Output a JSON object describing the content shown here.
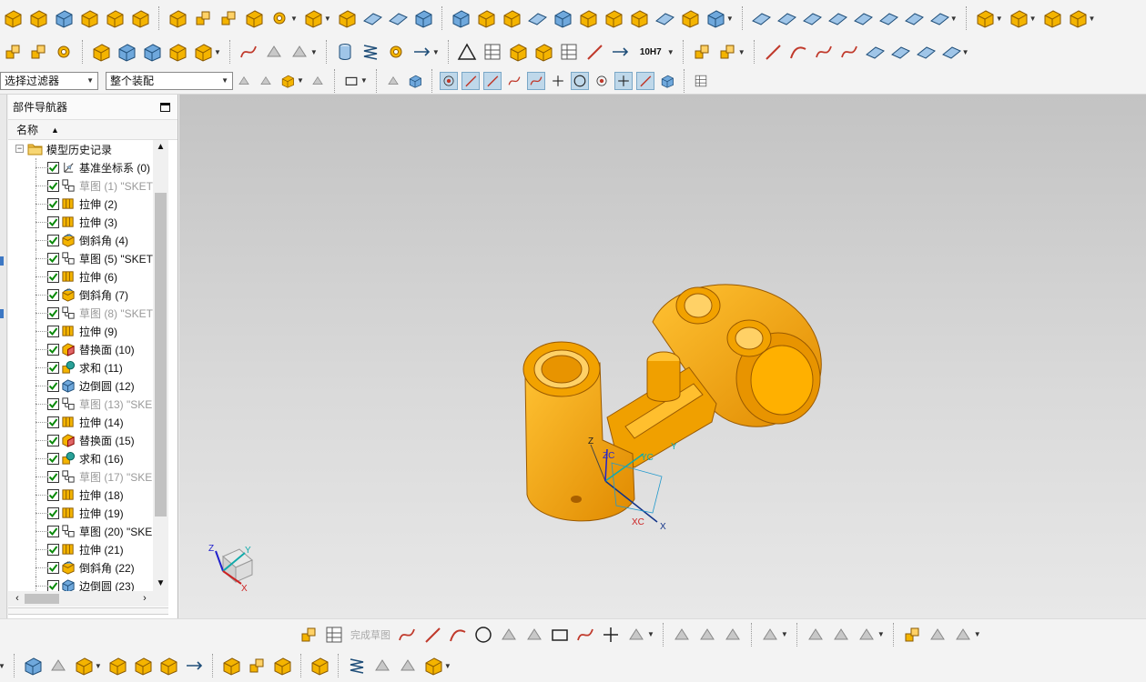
{
  "selection_filter": {
    "value": "选择过滤器"
  },
  "assembly_scope": {
    "value": "整个装配"
  },
  "navigator": {
    "title": "部件导航器",
    "column_header": "名称",
    "root_label": "模型历史记录",
    "items": [
      {
        "label": "基准坐标系 (0)",
        "type": "datum",
        "suppressed": false
      },
      {
        "label": "草图 (1) \"SKET",
        "type": "sketch",
        "suppressed": true
      },
      {
        "label": "拉伸 (2)",
        "type": "extrude",
        "suppressed": false
      },
      {
        "label": "拉伸 (3)",
        "type": "extrude",
        "suppressed": false
      },
      {
        "label": "倒斜角 (4)",
        "type": "chamfer",
        "suppressed": false
      },
      {
        "label": "草图 (5) \"SKET",
        "type": "sketch",
        "suppressed": false
      },
      {
        "label": "拉伸 (6)",
        "type": "extrude",
        "suppressed": false
      },
      {
        "label": "倒斜角 (7)",
        "type": "chamfer",
        "suppressed": false
      },
      {
        "label": "草图 (8) \"SKET",
        "type": "sketch",
        "suppressed": true
      },
      {
        "label": "拉伸 (9)",
        "type": "extrude",
        "suppressed": false
      },
      {
        "label": "替换面 (10)",
        "type": "replace",
        "suppressed": false
      },
      {
        "label": "求和 (11)",
        "type": "unite",
        "suppressed": false
      },
      {
        "label": "边倒圆 (12)",
        "type": "blend",
        "suppressed": false
      },
      {
        "label": "草图 (13) \"SKE",
        "type": "sketch",
        "suppressed": true
      },
      {
        "label": "拉伸 (14)",
        "type": "extrude",
        "suppressed": false
      },
      {
        "label": "替换面 (15)",
        "type": "replace",
        "suppressed": false
      },
      {
        "label": "求和 (16)",
        "type": "unite",
        "suppressed": false
      },
      {
        "label": "草图 (17) \"SKE",
        "type": "sketch",
        "suppressed": true
      },
      {
        "label": "拉伸 (18)",
        "type": "extrude",
        "suppressed": false
      },
      {
        "label": "拉伸 (19)",
        "type": "extrude",
        "suppressed": false
      },
      {
        "label": "草图 (20) \"SKE",
        "type": "sketch",
        "suppressed": false
      },
      {
        "label": "拉伸 (21)",
        "type": "extrude",
        "suppressed": false
      },
      {
        "label": "倒斜角 (22)",
        "type": "chamfer",
        "suppressed": false
      },
      {
        "label": "边倒圆 (23)",
        "type": "blend",
        "suppressed": false
      }
    ]
  },
  "toolbar": {
    "tolerance_label": "10H7",
    "finish_sketch_label": "完成草图"
  },
  "viewport": {
    "model_color": "#f5a300",
    "background_top": "#c3c3c3",
    "background_bottom": "#e8e8e8",
    "csys_labels": {
      "z": "Z",
      "zc": "ZC",
      "yc": "YC",
      "y": "Y",
      "xc": "XC",
      "x": "X"
    },
    "triad_labels": {
      "z": "Z",
      "y": "Y",
      "x": "X"
    }
  }
}
